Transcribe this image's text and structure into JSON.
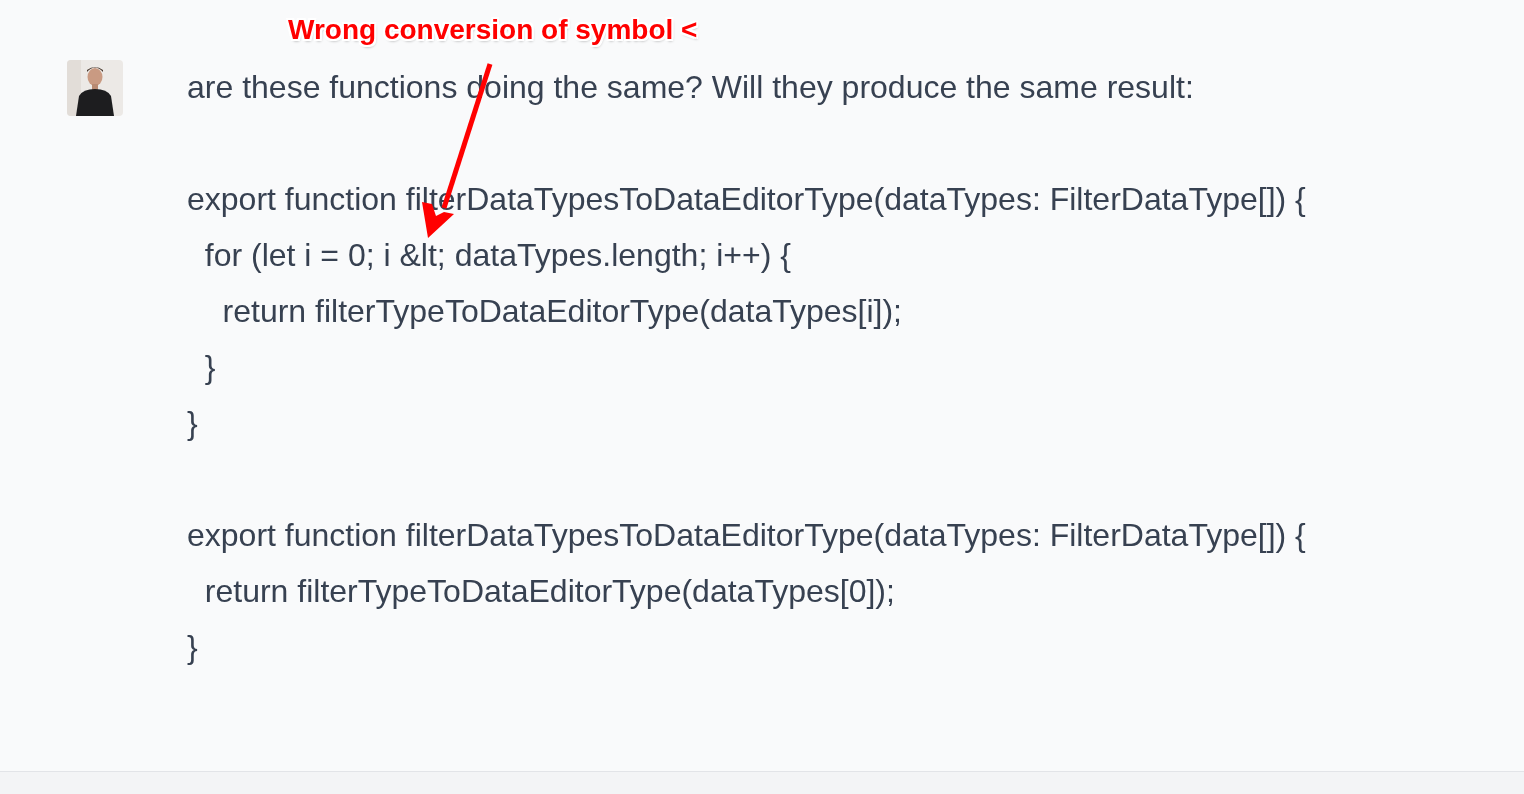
{
  "annotation": {
    "text": "Wrong conversion of symbol <"
  },
  "message": {
    "question": "are these functions doing the same? Will they produce the same result:",
    "code_blocks": [
      [
        "export function filterDataTypesToDataEditorType(dataTypes: FilterDataType[]) {",
        "  for (let i = 0; i &lt; dataTypes.length; i++) {",
        "    return filterTypeToDataEditorType(dataTypes[i]);",
        "  }",
        "}"
      ],
      [
        "export function filterDataTypesToDataEditorType(dataTypes: FilterDataType[]) {",
        "  return filterTypeToDataEditorType(dataTypes[0]);",
        "}"
      ]
    ]
  }
}
